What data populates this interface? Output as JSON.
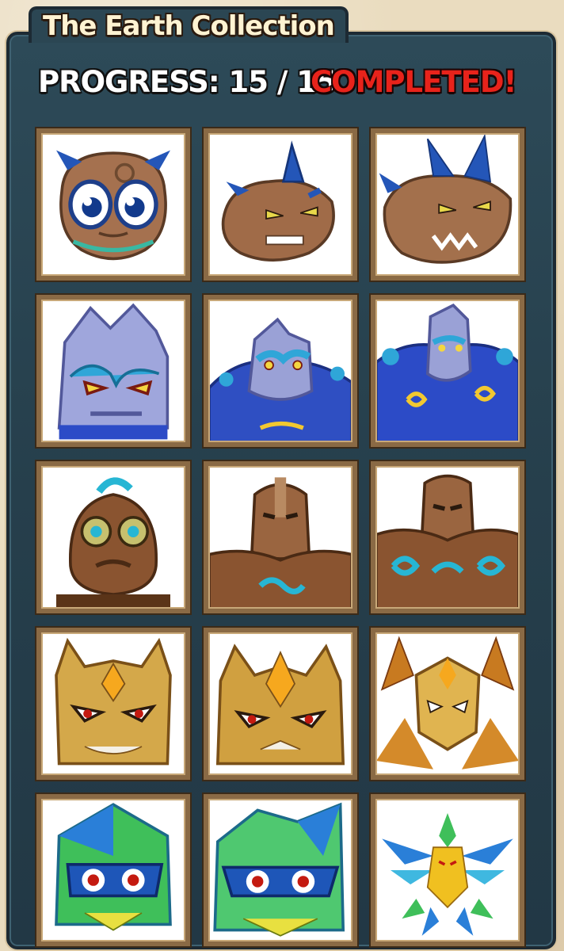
{
  "collection": {
    "title": "The Earth Collection",
    "progress_text": "PROGRESS: 15 / 15",
    "progress": {
      "collected": 15,
      "total": 15
    },
    "status_text": "COMPLETED!"
  },
  "colors": {
    "panel": "#2b4653",
    "frame": "#8a6a45",
    "completed": "#e8231b",
    "background": "#eadcbf"
  },
  "monsters": [
    {
      "stage": "baby",
      "family": "earth-dragon-blue-horns"
    },
    {
      "stage": "young",
      "family": "earth-dragon-blue-horns"
    },
    {
      "stage": "adult",
      "family": "earth-dragon-blue-horns"
    },
    {
      "stage": "baby",
      "family": "stone-golem-blue"
    },
    {
      "stage": "young",
      "family": "stone-golem-blue"
    },
    {
      "stage": "adult",
      "family": "stone-golem-blue"
    },
    {
      "stage": "baby",
      "family": "rock-golem-brown"
    },
    {
      "stage": "young",
      "family": "rock-golem-brown"
    },
    {
      "stage": "adult",
      "family": "rock-golem-brown"
    },
    {
      "stage": "baby",
      "family": "amber-crystal"
    },
    {
      "stage": "young",
      "family": "amber-crystal"
    },
    {
      "stage": "adult",
      "family": "amber-crystal"
    },
    {
      "stage": "baby",
      "family": "prism-crystal"
    },
    {
      "stage": "young",
      "family": "prism-crystal"
    },
    {
      "stage": "adult",
      "family": "prism-crystal"
    }
  ]
}
